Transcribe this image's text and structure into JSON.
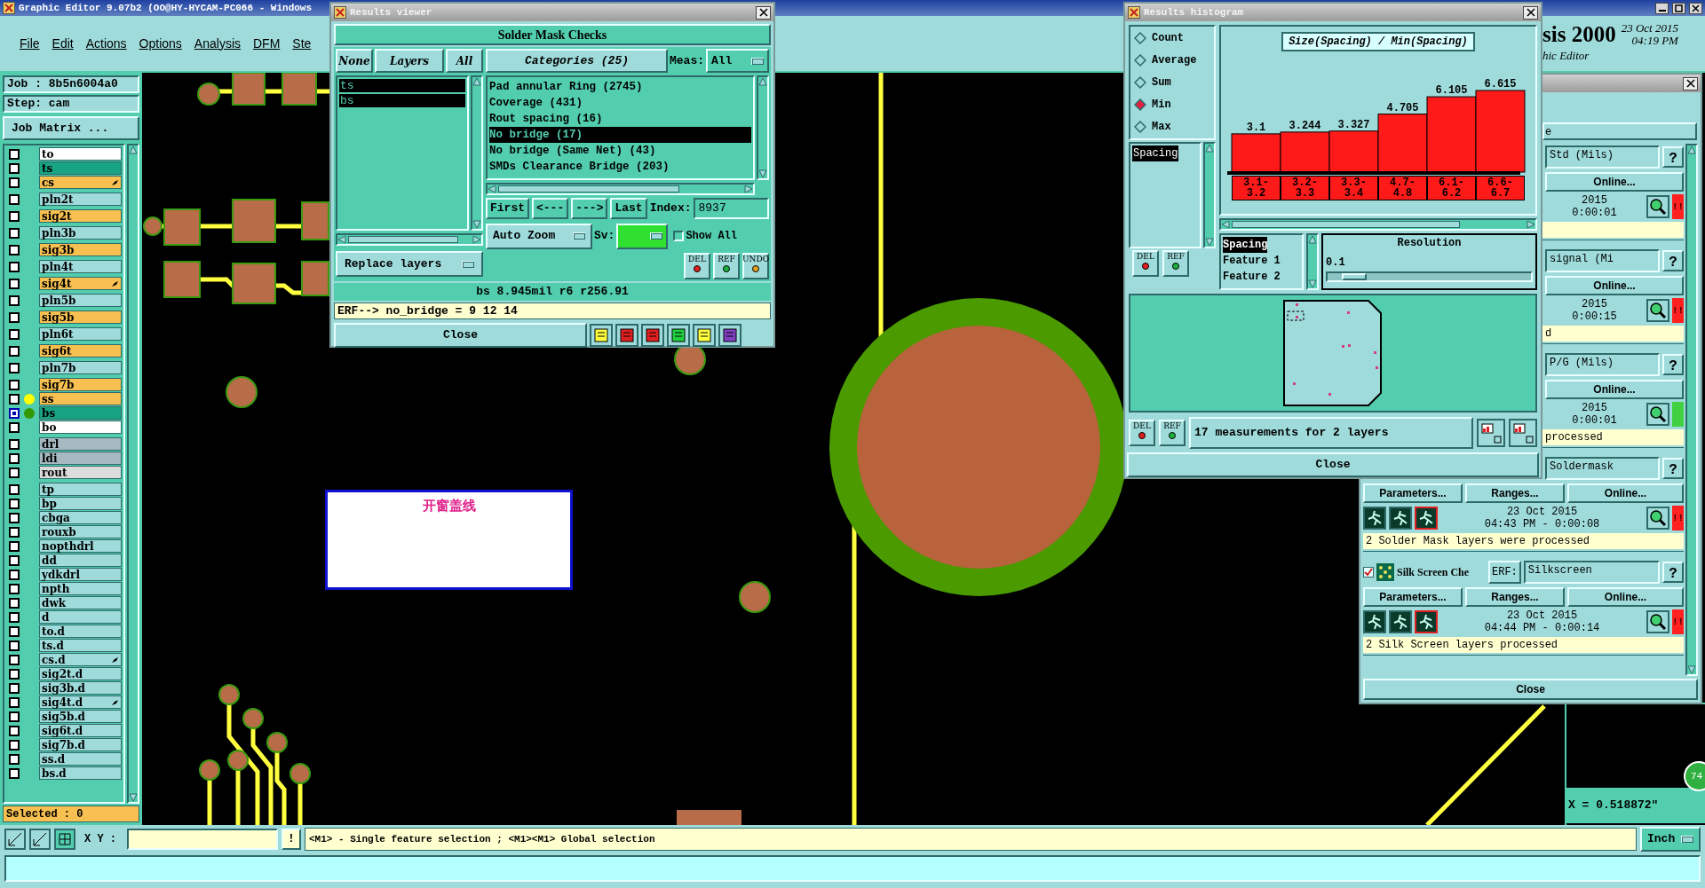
{
  "main_window": {
    "title": "Graphic Editor 9.07b2 (OO@HY-HYCAM-PC066 - Windows",
    "menu": [
      "File",
      "Edit",
      "Actions",
      "Options",
      "Analysis",
      "DFM",
      "Ste"
    ],
    "brand_fragment": "sis 2000",
    "subtitle_fragment": "hic Editor",
    "date": "23 Oct 2015",
    "time": "04:19 PM"
  },
  "job_panel": {
    "job": "Job : 8b5n6004a0",
    "step": "Step: cam",
    "matrix_button": "Job Matrix ...",
    "selected_count": "Selected : 0",
    "layer_groups": [
      [
        {
          "name": "to",
          "kind": "silk",
          "marked": false,
          "focused": false
        },
        {
          "name": "ts",
          "kind": "mask",
          "marked": false,
          "focused": false
        },
        {
          "name": "cs",
          "kind": "signal",
          "marked": true,
          "focused": false
        }
      ],
      [
        {
          "name": "pln2t",
          "kind": "plane",
          "marked": false,
          "focused": false
        }
      ],
      [
        {
          "name": "sig2t",
          "kind": "signal",
          "marked": false,
          "focused": false
        }
      ],
      [
        {
          "name": "pln3b",
          "kind": "plane",
          "marked": false,
          "focused": false
        }
      ],
      [
        {
          "name": "sig3b",
          "kind": "signal",
          "marked": false,
          "focused": false
        }
      ],
      [
        {
          "name": "pln4t",
          "kind": "plane",
          "marked": false,
          "focused": false
        }
      ],
      [
        {
          "name": "sig4t",
          "kind": "signal",
          "marked": true,
          "focused": false
        }
      ],
      [
        {
          "name": "pln5b",
          "kind": "plane",
          "marked": false,
          "focused": false
        }
      ],
      [
        {
          "name": "sig5b",
          "kind": "signal",
          "marked": false,
          "focused": false
        }
      ],
      [
        {
          "name": "pln6t",
          "kind": "plane",
          "marked": false,
          "focused": false
        }
      ],
      [
        {
          "name": "sig6t",
          "kind": "signal",
          "marked": false,
          "focused": false
        }
      ],
      [
        {
          "name": "pln7b",
          "kind": "plane",
          "marked": false,
          "focused": false
        }
      ],
      [
        {
          "name": "sig7b",
          "kind": "signal",
          "marked": false,
          "focused": false
        },
        {
          "name": "ss",
          "kind": "signal",
          "marked": false,
          "focused": false,
          "color": "#ffff00"
        },
        {
          "name": "bs",
          "kind": "mask",
          "marked": false,
          "focused": true,
          "color": "#339900"
        },
        {
          "name": "bo",
          "kind": "silk",
          "marked": false,
          "focused": false
        }
      ],
      [
        {
          "name": "drl",
          "kind": "drill",
          "marked": false,
          "focused": false
        },
        {
          "name": "ldi",
          "kind": "drill",
          "marked": false,
          "focused": false
        },
        {
          "name": "rout",
          "kind": "rout",
          "marked": false,
          "focused": false
        }
      ],
      [
        {
          "name": "tp",
          "kind": "misc",
          "marked": false,
          "focused": false
        },
        {
          "name": "bp",
          "kind": "misc",
          "marked": false,
          "focused": false
        },
        {
          "name": "cbga",
          "kind": "misc",
          "marked": false,
          "focused": false
        },
        {
          "name": "rouxb",
          "kind": "misc",
          "marked": false,
          "focused": false
        },
        {
          "name": "nopthdrl",
          "kind": "misc",
          "marked": false,
          "focused": false
        },
        {
          "name": "dd",
          "kind": "misc",
          "marked": false,
          "focused": false
        },
        {
          "name": "ydkdrl",
          "kind": "misc",
          "marked": false,
          "focused": false
        },
        {
          "name": "npth",
          "kind": "misc",
          "marked": false,
          "focused": false
        },
        {
          "name": "dwk",
          "kind": "misc",
          "marked": false,
          "focused": false
        },
        {
          "name": "d",
          "kind": "misc",
          "marked": false,
          "focused": false
        },
        {
          "name": "to.d",
          "kind": "misc",
          "marked": false,
          "focused": false
        },
        {
          "name": "ts.d",
          "kind": "misc",
          "marked": false,
          "focused": false
        },
        {
          "name": "cs.d",
          "kind": "misc",
          "marked": true,
          "focused": false
        },
        {
          "name": "sig2t.d",
          "kind": "misc",
          "marked": false,
          "focused": false
        },
        {
          "name": "sig3b.d",
          "kind": "misc",
          "marked": false,
          "focused": false
        },
        {
          "name": "sig4t.d",
          "kind": "misc",
          "marked": true,
          "focused": false
        },
        {
          "name": "sig5b.d",
          "kind": "misc",
          "marked": false,
          "focused": false
        },
        {
          "name": "sig6t.d",
          "kind": "misc",
          "marked": false,
          "focused": false
        },
        {
          "name": "sig7b.d",
          "kind": "misc",
          "marked": false,
          "focused": false
        },
        {
          "name": "ss.d",
          "kind": "misc",
          "marked": false,
          "focused": false
        },
        {
          "name": "bs.d",
          "kind": "misc",
          "marked": false,
          "focused": false
        }
      ]
    ]
  },
  "canvas": {
    "note": "开窗盖线"
  },
  "results_viewer": {
    "title": "Results viewer",
    "heading": "Solder Mask Checks",
    "layer_buttons": [
      "None",
      "Layers",
      "All"
    ],
    "layers": [
      {
        "name": "ts",
        "selected": true
      },
      {
        "name": "bs",
        "selected": true
      }
    ],
    "replace_menu": "Replace layers",
    "categories_button": "Categories (25)",
    "meas_label": "Meas:",
    "meas_value": "All",
    "categories": [
      {
        "label": "Pad annular Ring (2745)",
        "selected": false
      },
      {
        "label": "Coverage (431)",
        "selected": false
      },
      {
        "label": "Rout spacing (16)",
        "selected": false
      },
      {
        "label": "No bridge (17)",
        "selected": true
      },
      {
        "label": "No bridge (Same Net) (43)",
        "selected": false
      },
      {
        "label": "SMDs Clearance Bridge (203)",
        "selected": false
      }
    ],
    "nav_buttons": [
      "First",
      "<---",
      "--->",
      "Last"
    ],
    "index_label": "Index:",
    "index_value": "8937",
    "zoom_menu": "Auto Zoom",
    "sv_label": "Sv:",
    "show_all": {
      "label": "Show All",
      "checked": false
    },
    "action_buttons": [
      "DEL",
      "REF",
      "UNDO"
    ],
    "measurement": "bs 8.945mil r6 r256.91",
    "erf_line": "ERF--> no_bridge = 9 12 14",
    "close": "Close"
  },
  "histogram": {
    "title": "Results histogram",
    "modes": [
      {
        "label": "Count",
        "selected": false
      },
      {
        "label": "Average",
        "selected": false
      },
      {
        "label": "Sum",
        "selected": false
      },
      {
        "label": "Min",
        "selected": true
      },
      {
        "label": "Max",
        "selected": false
      }
    ],
    "attributes": [
      {
        "label": "Spacing",
        "selected": true
      }
    ],
    "side_buttons": [
      "DEL",
      "REF"
    ],
    "chart_data": {
      "type": "bar",
      "title": "Size(Spacing) / Min(Spacing)",
      "categories": [
        "3.1-3.2",
        "3.2-3.3",
        "3.3-3.4",
        "4.7-4.8",
        "6.1-6.2",
        "6.6-6.7"
      ],
      "values": [
        3.1,
        3.244,
        3.327,
        4.705,
        6.105,
        6.615
      ],
      "data_labels": true
    },
    "fields": [
      {
        "label": "Spacing",
        "selected": true
      },
      {
        "label": "Feature 1",
        "selected": false
      },
      {
        "label": "Feature 2",
        "selected": false
      }
    ],
    "resolution": {
      "label": "Resolution",
      "value": "0.1",
      "level": 0.07
    },
    "bottom_buttons": [
      "DEL",
      "REF"
    ],
    "summary": "17 measurements for 2 layers",
    "close": "Close"
  },
  "checklist": {
    "header_fragment": "e",
    "close": "Close",
    "rows": [
      {
        "kind": "partial",
        "erf_value": "Std (Mils)",
        "help": "?",
        "online": "Online...",
        "date": "2015",
        "time": "0:00:01",
        "color": "#ff2020",
        "status_text": "!!"
      },
      {
        "kind": "partial",
        "erf_value": "signal (Mi",
        "help": "?",
        "online": "Online...",
        "date": "2015",
        "time": "0:00:15",
        "color": "#ff2020",
        "status_text": "!!",
        "message": "d"
      },
      {
        "kind": "partial",
        "erf_value": "P/G (Mils)",
        "help": "?",
        "online": "Online...",
        "date": "2015",
        "time": "0:00:01",
        "color": "#40d040",
        "message": "processed"
      },
      {
        "kind": "lower",
        "erf_value": "Soldermask",
        "help": "?",
        "parameters": "Parameters...",
        "ranges": "Ranges...",
        "online": "Online...",
        "date": "23 Oct 2015",
        "time": "04:43 PM - 0:00:08",
        "color": "#ff2020",
        "status_text": "!!",
        "message": "2 Solder Mask layers were processed"
      },
      {
        "kind": "full",
        "checked": true,
        "name": "Silk Screen Che",
        "erf_label": "ERF:",
        "erf_value": "Silkscreen",
        "help": "?",
        "parameters": "Parameters...",
        "ranges": "Ranges...",
        "online": "Online...",
        "date": "23 Oct 2015",
        "time": "04:44 PM - 0:00:14",
        "color": "#ff2020",
        "status_text": "!!",
        "message": "2 Silk Screen layers processed"
      }
    ]
  },
  "coordinates": {
    "readout": "X = 0.518872\"",
    "badge": "74"
  },
  "toolbar": {
    "xy_label": "X Y :",
    "bang": "!",
    "hint": "<M1> - Single feature selection ; <M1><M1> Global selection",
    "units": "Inch"
  }
}
